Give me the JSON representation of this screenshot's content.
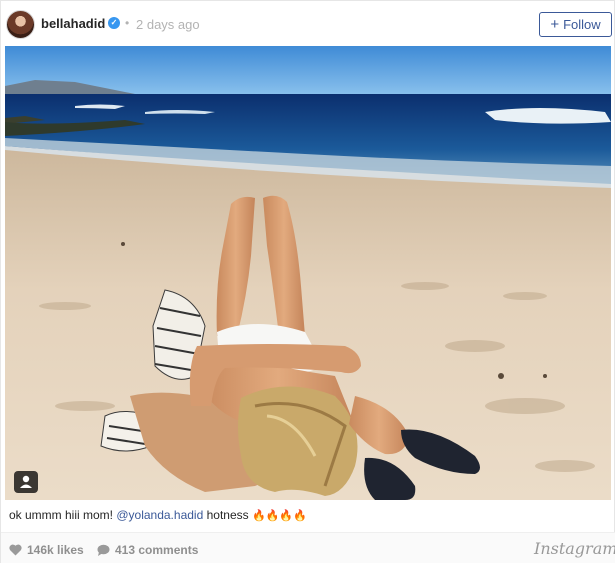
{
  "header": {
    "username": "bellahadid",
    "separator": "•",
    "timestamp": "2 days ago",
    "follow_label": "Follow",
    "follow_plus": "+"
  },
  "caption": {
    "text_before": "ok ummm hiii mom! ",
    "mention": "@yolanda.hadid",
    "text_after": " hotness ",
    "flames": "🔥🔥🔥🔥"
  },
  "footer": {
    "likes": "146k likes",
    "comments": "413 comments",
    "brand": "Instagram"
  },
  "icons": {
    "verified": "verified-badge-icon",
    "heart": "heart-icon",
    "comment": "comment-icon",
    "tagged_user": "tagged-user-icon"
  },
  "colors": {
    "link": "#3b5998",
    "verified": "#3897f0",
    "muted": "#b3b3b3"
  }
}
